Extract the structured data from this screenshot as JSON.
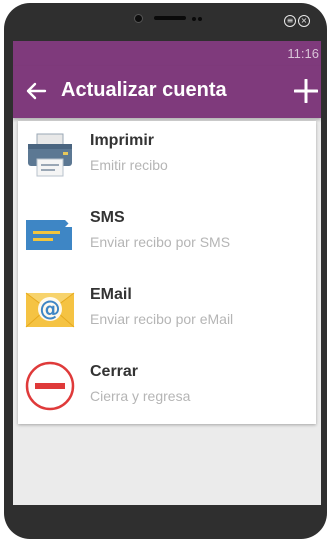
{
  "statusbar": {
    "time": "11:16"
  },
  "appbar": {
    "title": "Actualizar cuenta"
  },
  "menu": {
    "items": [
      {
        "title": "Imprimir",
        "subtitle": "Emitir recibo",
        "icon": "printer-icon"
      },
      {
        "title": "SMS",
        "subtitle": "Enviar recibo por SMS",
        "icon": "sms-icon"
      },
      {
        "title": "EMail",
        "subtitle": "Enviar recibo por eMail",
        "icon": "email-icon"
      },
      {
        "title": "Cerrar",
        "subtitle": "Cierra y regresa",
        "icon": "close-circle-icon"
      }
    ]
  },
  "colors": {
    "appbar": "#7f3a7c",
    "device": "#2f2f2f",
    "background": "#ebebeb"
  }
}
